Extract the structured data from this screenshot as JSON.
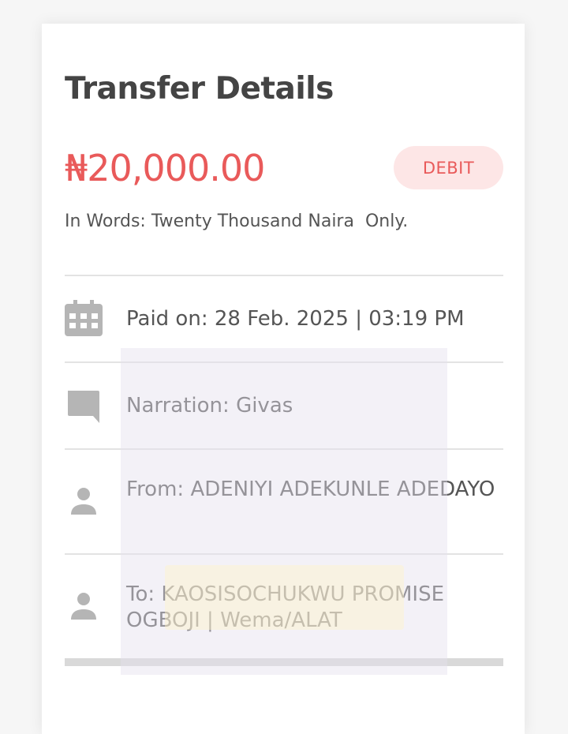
{
  "header": {
    "title": "Transfer Details"
  },
  "transaction": {
    "amount": "₦20,000.00",
    "type_badge": "DEBIT",
    "in_words": "In Words: Twenty Thousand Naira  Only."
  },
  "details": {
    "paid_on": "Paid on: 28 Feb. 2025 | 03:19 PM",
    "narration": "Narration: Givas",
    "from": "From: ADENIYI ADEKUNLE ADEDAYO",
    "to": "To: KAOSISOCHUKWU PROMISE OGBOJI | Wema/ALAT"
  },
  "icons": {
    "paid_on": "calendar-icon",
    "narration": "comment-icon",
    "from": "person-icon",
    "to": "person-icon"
  },
  "colors": {
    "amount": "#e95a5a",
    "badge_background": "#fde6e6",
    "title": "#444444",
    "icon": "#b5b5b5",
    "divider": "#e3e3e3"
  }
}
